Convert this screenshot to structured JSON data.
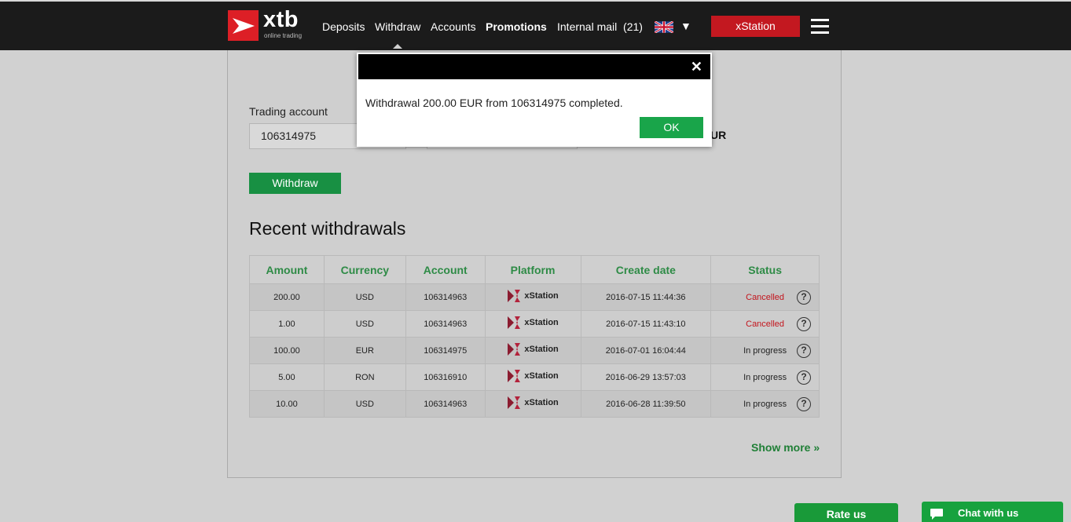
{
  "brand": {
    "word": "xtb",
    "tagline": "online trading",
    "color": "#dd1f26"
  },
  "nav": {
    "items": [
      "Deposits",
      "Withdraw",
      "Accounts",
      "Promotions",
      "Internal mail  (21)"
    ],
    "language_caret": "▼",
    "xstation_label": "xStation"
  },
  "form": {
    "trading_account_label": "Trading account",
    "trading_account_value": "106314975",
    "currency_peek": "UR",
    "withdraw_label": "Withdraw"
  },
  "recent": {
    "title": "Recent withdrawals",
    "columns": [
      "Amount",
      "Currency",
      "Account",
      "Platform",
      "Create date",
      "Status"
    ],
    "rows": [
      {
        "amount": "200.00",
        "currency": "USD",
        "account": "106314963",
        "platform": "xStation",
        "date": "2016-07-15 11:44:36",
        "status": "Cancelled",
        "help": "?"
      },
      {
        "amount": "1.00",
        "currency": "USD",
        "account": "106314963",
        "platform": "xStation",
        "date": "2016-07-15 11:43:10",
        "status": "Cancelled",
        "help": "?"
      },
      {
        "amount": "100.00",
        "currency": "EUR",
        "account": "106314975",
        "platform": "xStation",
        "date": "2016-07-01 16:04:44",
        "status": "In progress",
        "help": "?"
      },
      {
        "amount": "5.00",
        "currency": "RON",
        "account": "106316910",
        "platform": "xStation",
        "date": "2016-06-29 13:57:03",
        "status": "In progress",
        "help": "?"
      },
      {
        "amount": "10.00",
        "currency": "USD",
        "account": "106314963",
        "platform": "xStation",
        "date": "2016-06-28 11:39:50",
        "status": "In progress",
        "help": "?"
      }
    ],
    "show_more": "Show more »"
  },
  "footer": {
    "rate_label": "Rate us",
    "chat_label": "Chat with us"
  },
  "modal": {
    "close": "✕",
    "message": "Withdrawal 200.00 EUR from 106314975 completed.",
    "ok_label": "OK"
  },
  "colors": {
    "accent_green": "#189043",
    "header_green": "#2e8b46",
    "cancelled_red": "#c3141c",
    "topbar": "#1b1b1b",
    "xstation_red": "#c31820"
  },
  "icons": {
    "logo": "xtb-logo-icon",
    "language": "uk-flag-icon",
    "menu": "hamburger-menu-icon",
    "platform": "xstation-logo-icon",
    "help": "help-circle-icon",
    "chat": "chat-bubble-icon",
    "close": "close-icon"
  }
}
